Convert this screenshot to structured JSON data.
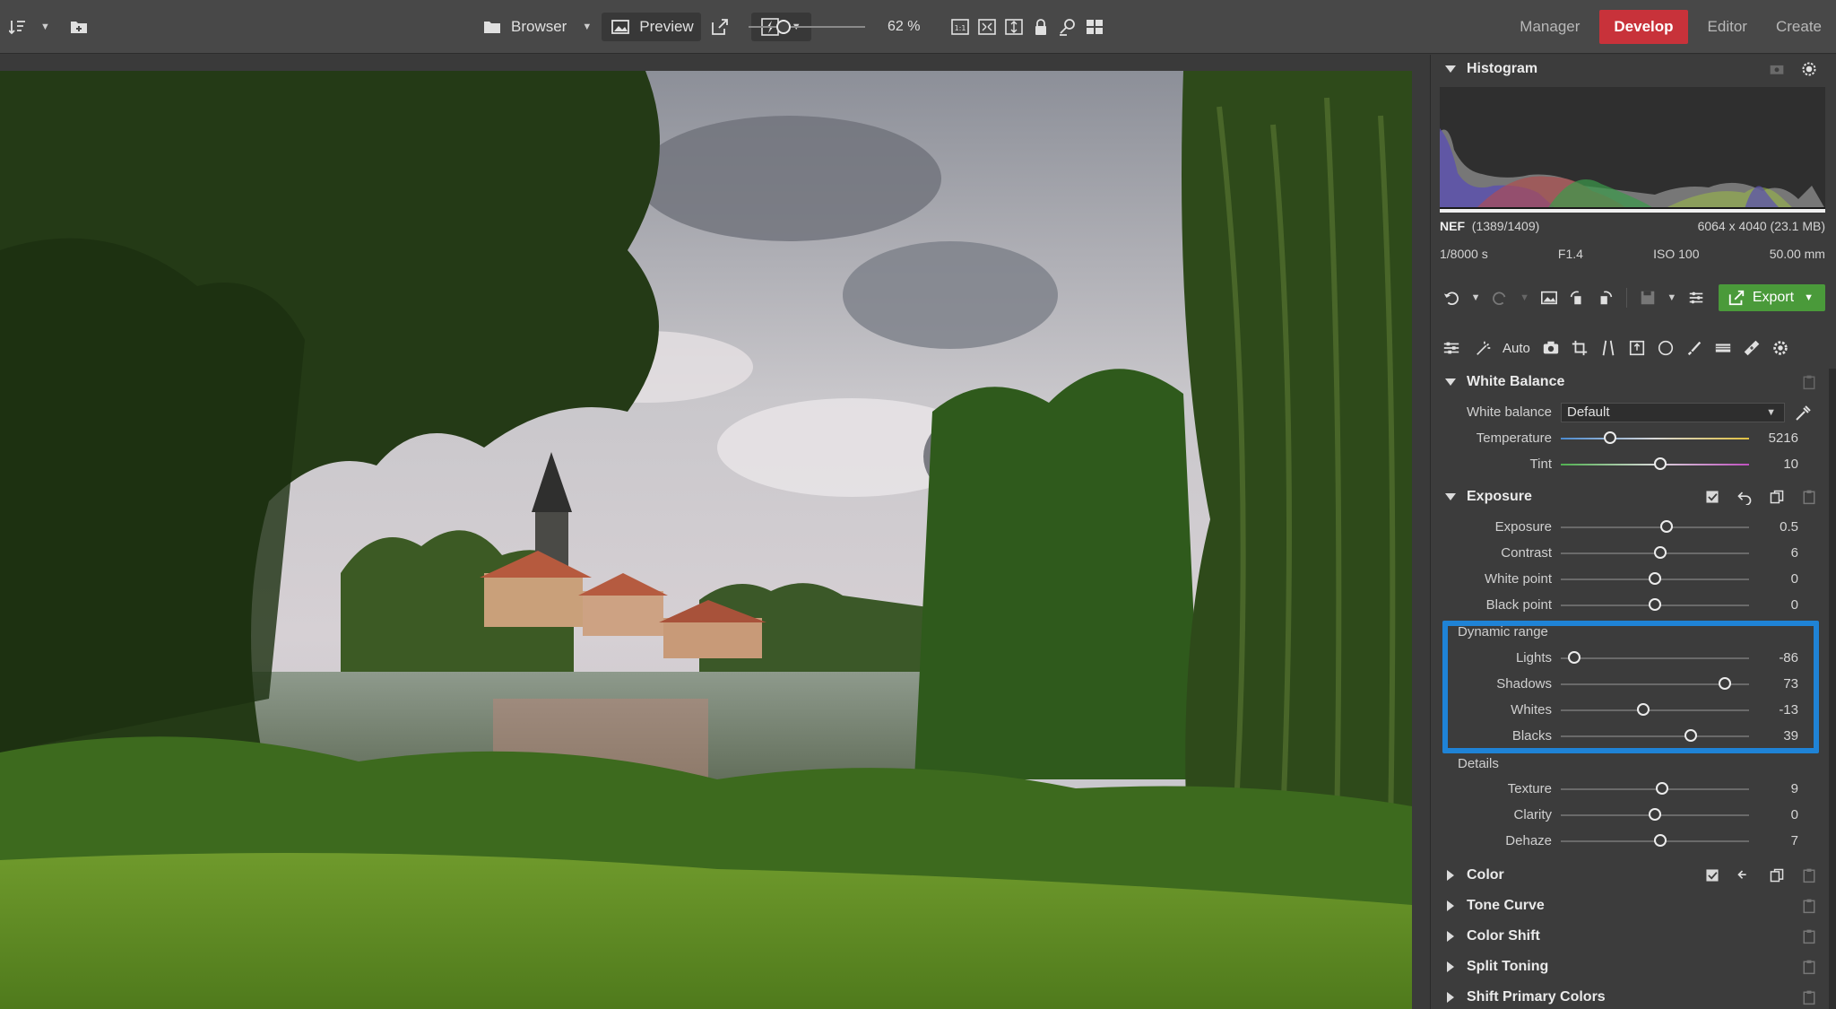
{
  "toolbar": {
    "sort_label": "",
    "browser_label": "Browser",
    "preview_label": "Preview",
    "zoom_fraction": 0.3,
    "zoom_value": "62 %",
    "modules": [
      {
        "label": "Manager",
        "active": false
      },
      {
        "label": "Develop",
        "active": true
      },
      {
        "label": "Editor",
        "active": false
      },
      {
        "label": "Create",
        "active": false
      }
    ]
  },
  "panel": {
    "histogram": {
      "title": "Histogram",
      "format": "NEF",
      "index": "(1389/1409)",
      "dimensions": "6064 x 4040 (23.1 MB)",
      "shutter": "1/8000 s",
      "aperture": "F1.4",
      "iso": "ISO 100",
      "focal": "50.00 mm"
    },
    "export_label": "Export",
    "auto_label": "Auto",
    "white_balance": {
      "title": "White Balance",
      "wb_label": "White balance",
      "wb_value": "Default",
      "temperature": {
        "label": "Temperature",
        "value": "5216",
        "pos": 0.26
      },
      "tint": {
        "label": "Tint",
        "value": "10",
        "pos": 0.53
      }
    },
    "exposure": {
      "title": "Exposure",
      "exposure": {
        "label": "Exposure",
        "value": "0.5",
        "pos": 0.56
      },
      "contrast": {
        "label": "Contrast",
        "value": "6",
        "pos": 0.53
      },
      "white_point": {
        "label": "White point",
        "value": "0",
        "pos": 0.5
      },
      "black_point": {
        "label": "Black point",
        "value": "0",
        "pos": 0.5
      },
      "dynamic_range_label": "Dynamic range",
      "lights": {
        "label": "Lights",
        "value": "-86",
        "pos": 0.07
      },
      "shadows": {
        "label": "Shadows",
        "value": "73",
        "pos": 0.87
      },
      "whites": {
        "label": "Whites",
        "value": "-13",
        "pos": 0.44
      },
      "blacks": {
        "label": "Blacks",
        "value": "39",
        "pos": 0.69
      },
      "details_label": "Details",
      "texture": {
        "label": "Texture",
        "value": "9",
        "pos": 0.54
      },
      "clarity": {
        "label": "Clarity",
        "value": "0",
        "pos": 0.5
      },
      "dehaze": {
        "label": "Dehaze",
        "value": "7",
        "pos": 0.53
      }
    },
    "collapsed_sections": [
      "Color",
      "Tone Curve",
      "Color Shift",
      "Split Toning",
      "Shift Primary Colors"
    ]
  }
}
